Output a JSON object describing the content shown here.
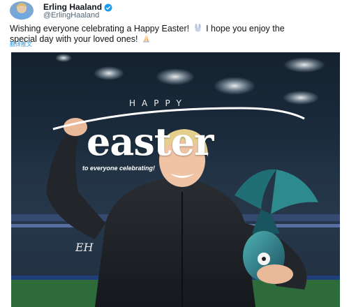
{
  "tweet": {
    "display_name": "Erling Haaland",
    "handle": "@ErlingHaaland",
    "text_line1": "Wishing everyone celebrating a Happy Easter!",
    "text_line1b": "I hope you enjoy the",
    "text_line2": "special day with your loved ones!",
    "translate_label": "翻译推文"
  },
  "image": {
    "happy": "HAPPY",
    "easter": "easter",
    "subtitle": "to everyone celebrating!",
    "signature": "EH"
  },
  "icons": {
    "verified": "verified-badge-icon",
    "bunny": "rabbit-emoji",
    "hands": "folded-hands-emoji"
  },
  "colors": {
    "verified": "#1d9bf0",
    "link": "#1d9bf0",
    "egg": "#2b7e84"
  }
}
